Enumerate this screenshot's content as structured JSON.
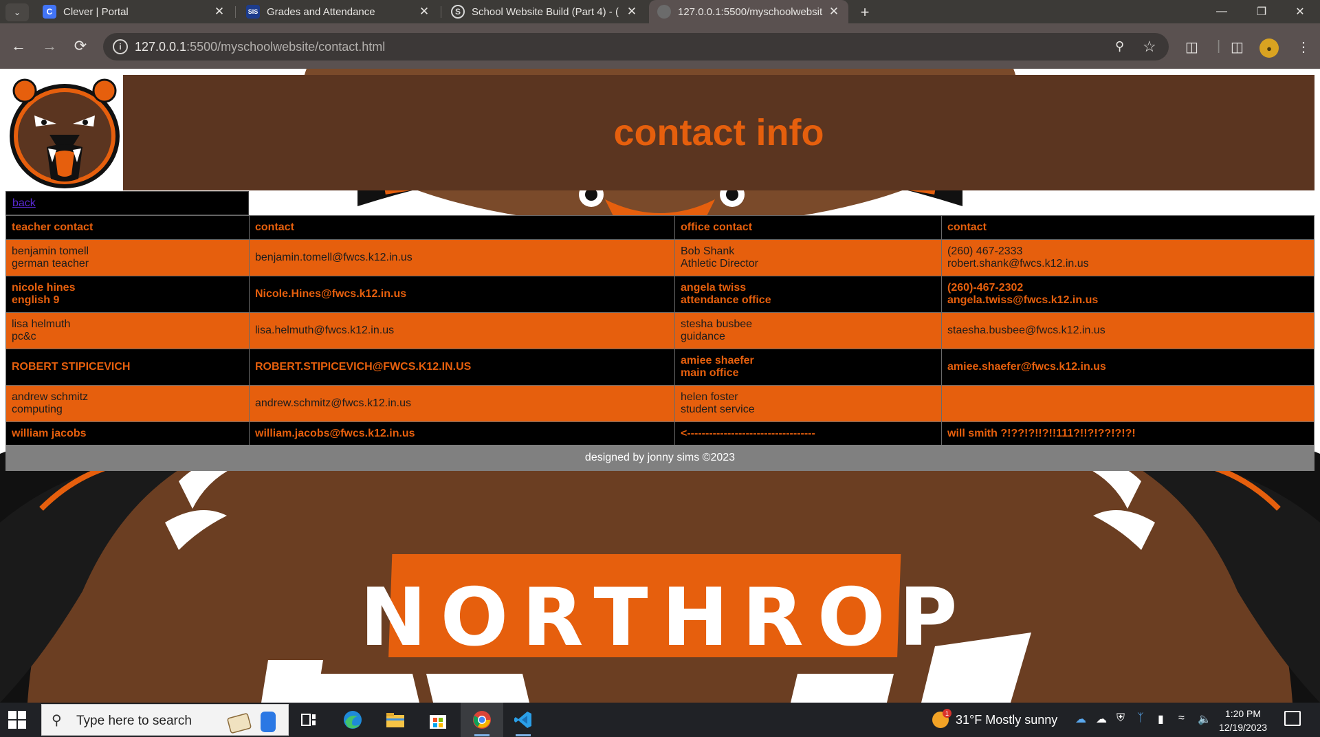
{
  "browser": {
    "tabs": [
      {
        "title": "Clever | Portal",
        "favicon": "C",
        "favicon_color": "#4274f6"
      },
      {
        "title": "Grades and Attendance",
        "favicon": "SIS",
        "favicon_color": "#1d3c8c"
      },
      {
        "title": "School Website Build (Part 4) - (",
        "favicon": "S",
        "favicon_color": "#3a6ea5"
      },
      {
        "title": "127.0.0.1:5500/myschoolwebsit",
        "favicon": "",
        "favicon_color": "#6b6b6b"
      }
    ],
    "active_tab_index": 3,
    "url_host": "127.0.0.1",
    "url_rest": ":5500/myschoolwebsite/contact.html"
  },
  "page": {
    "heading": "contact info",
    "back_link": "back",
    "table": {
      "headers": [
        "teacher contact",
        "contact",
        "office contact",
        "contact"
      ],
      "rows": [
        {
          "style": "orange",
          "cells": [
            [
              "benjamin tomell",
              "german teacher"
            ],
            [
              "benjamin.tomell@fwcs.k12.in.us"
            ],
            [
              "Bob Shank",
              "Athletic Director"
            ],
            [
              "(260) 467-2333",
              "robert.shank@fwcs.k12.in.us"
            ]
          ]
        },
        {
          "style": "black",
          "cells": [
            [
              "nicole hines",
              "english 9"
            ],
            [
              "Nicole.Hines@fwcs.k12.in.us"
            ],
            [
              "angela twiss",
              "attendance office"
            ],
            [
              "(260)-467-2302",
              "angela.twiss@fwcs.k12.in.us"
            ]
          ]
        },
        {
          "style": "orange",
          "cells": [
            [
              "lisa helmuth",
              "pc&c"
            ],
            [
              "lisa.helmuth@fwcs.k12.in.us"
            ],
            [
              "stesha busbee",
              "guidance"
            ],
            [
              "staesha.busbee@fwcs.k12.in.us"
            ]
          ]
        },
        {
          "style": "black",
          "cells": [
            [
              "ROBERT STIPICEVICH"
            ],
            [
              "ROBERT.STIPICEVICH@FWCS.K12.IN.US"
            ],
            [
              "amiee shaefer",
              "main office"
            ],
            [
              "amiee.shaefer@fwcs.k12.in.us"
            ]
          ]
        },
        {
          "style": "orange",
          "cells": [
            [
              "andrew schmitz",
              "computing"
            ],
            [
              "andrew.schmitz@fwcs.k12.in.us"
            ],
            [
              "helen foster",
              "student service"
            ],
            [
              ""
            ]
          ]
        },
        {
          "style": "black short",
          "cells": [
            [
              "william jacobs"
            ],
            [
              "william.jacobs@fwcs.k12.in.us"
            ],
            [
              "<-----------------------------------"
            ],
            [
              "will smith ?!??!?!!?!!111?!!?!??!?!?!"
            ]
          ]
        }
      ]
    },
    "footer": "designed by jonny sims ©2023",
    "background_text": "NORTHROP",
    "colors": {
      "brand_orange": "#e65f0d",
      "brand_brown": "#5b3520",
      "black": "#000000"
    }
  },
  "taskbar": {
    "search_placeholder": "Type here to search",
    "weather": "31°F  Mostly sunny",
    "weather_badge": "1",
    "time": "1:20 PM",
    "date": "12/19/2023"
  }
}
